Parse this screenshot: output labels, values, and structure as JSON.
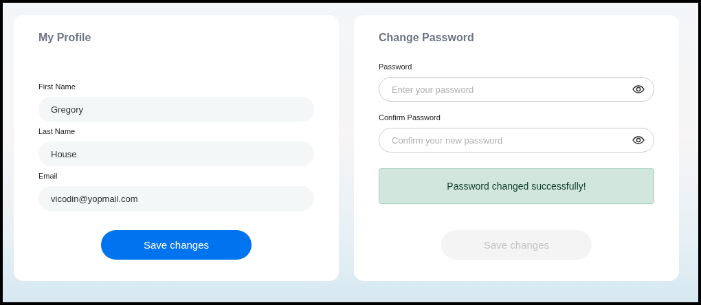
{
  "profile": {
    "title": "My Profile",
    "fields": [
      {
        "kind": "text",
        "label": "First Name",
        "value": "Gregory"
      },
      {
        "kind": "text",
        "label": "Last Name",
        "value": "House"
      },
      {
        "kind": "text",
        "label": "Email",
        "value": "vicodin@yopmail.com"
      }
    ],
    "button": {
      "label": "Save changes",
      "disabled": false
    }
  },
  "change_password": {
    "title": "Change Password",
    "fields": [
      {
        "kind": "password",
        "label": "Password",
        "placeholder": "Enter your password"
      },
      {
        "kind": "password",
        "label": "Confirm Password",
        "placeholder": "Confirm your new password"
      }
    ],
    "message": "Password changed successfully!",
    "button": {
      "label": "Save changes",
      "disabled": true
    }
  }
}
